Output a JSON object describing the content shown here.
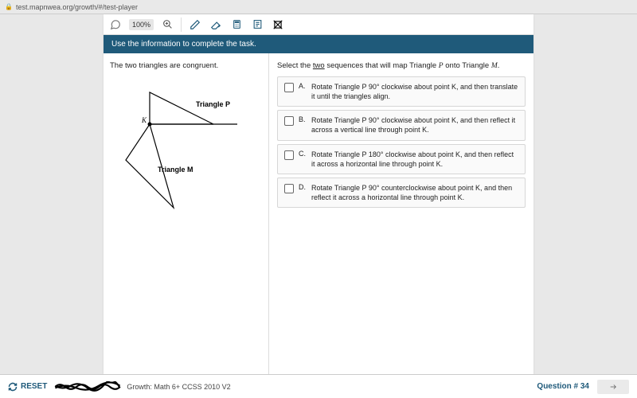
{
  "url": "test.mapnwea.org/growth/#/test-player",
  "zoom": "100%",
  "instruction": "Use the information to complete the task.",
  "left_statement": "The two triangles are congruent.",
  "diagram": {
    "label_P": "Triangle P",
    "label_M": "Triangle M",
    "label_K": "K"
  },
  "prompt": {
    "pre": "Select the ",
    "underlined": "two",
    "post": " sequences that will map Triangle ",
    "var1": "P",
    "mid": " onto Triangle ",
    "var2": "M",
    "end": "."
  },
  "options": [
    {
      "letter": "A.",
      "text": "Rotate Triangle P 90° clockwise about point K, and then translate it until the triangles align."
    },
    {
      "letter": "B.",
      "text": "Rotate Triangle P 90° clockwise about point K, and then reflect it across a vertical line through point K."
    },
    {
      "letter": "C.",
      "text": "Rotate Triangle P 180° clockwise about point K, and then reflect it across a horizontal line through point K."
    },
    {
      "letter": "D.",
      "text": "Rotate Triangle P 90° counterclockwise about point K, and then reflect it across a horizontal line through point K."
    }
  ],
  "footer": {
    "reset": "RESET",
    "assessment": "Growth: Math 6+ CCSS 2010 V2",
    "question": "Question # 34"
  }
}
